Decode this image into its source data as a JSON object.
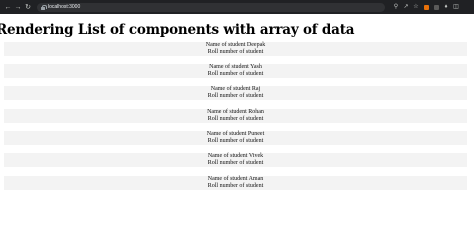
{
  "browser": {
    "url": "localhost:3000",
    "icons": [
      "back-icon",
      "forward-icon",
      "reload-icon",
      "zoom-icon",
      "share-icon",
      "star-icon",
      "extension-icon",
      "extension-icon",
      "puzzle-icon",
      "split-view-icon"
    ],
    "extension_colors": [
      "#e8710a",
      "#5a5a5a"
    ]
  },
  "page": {
    "title": "Rendering List of components with array of data",
    "students": [
      {
        "name_line": "Name of student Deepak",
        "roll_line": "Roll number of student"
      },
      {
        "name_line": "Name of student Yash",
        "roll_line": "Roll number of student"
      },
      {
        "name_line": "Name of student Raj",
        "roll_line": "Roll number of student"
      },
      {
        "name_line": "Name of student Rohan",
        "roll_line": "Roll number of student"
      },
      {
        "name_line": "Name of student Puneet",
        "roll_line": "Roll number of student"
      },
      {
        "name_line": "Name of student Vivek",
        "roll_line": "Roll number of student"
      },
      {
        "name_line": "Name of student Aman",
        "roll_line": "Roll number of student"
      }
    ]
  }
}
